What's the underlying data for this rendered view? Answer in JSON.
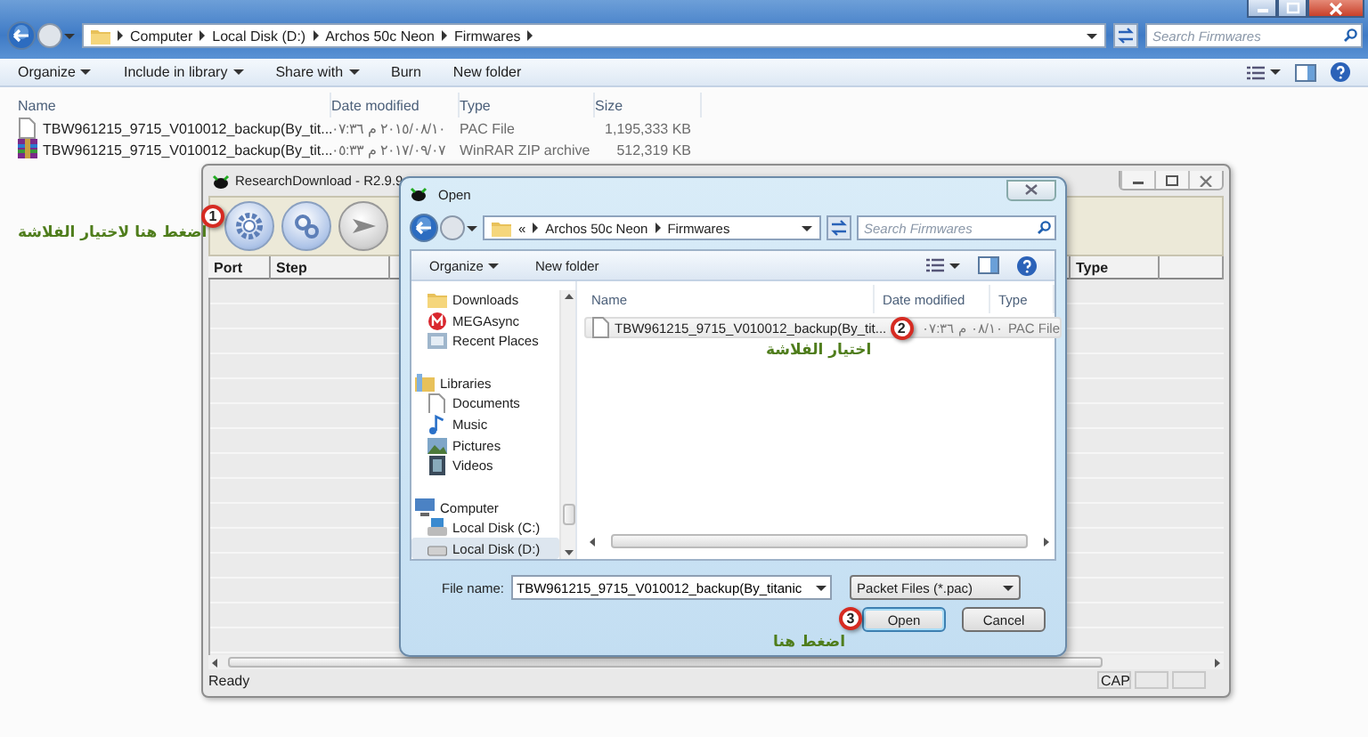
{
  "explorer": {
    "address": [
      "Computer",
      "Local Disk (D:)",
      "Archos 50c Neon",
      "Firmwares"
    ],
    "search": {
      "placeholder": "Search Firmwares"
    },
    "toolbar": [
      {
        "label": "Organize",
        "dropdown": true
      },
      {
        "label": "Include in library",
        "dropdown": true
      },
      {
        "label": "Share with",
        "dropdown": true
      },
      {
        "label": "Burn",
        "dropdown": false
      },
      {
        "label": "New folder",
        "dropdown": false
      }
    ],
    "columns": [
      "Name",
      "Date modified",
      "Type",
      "Size"
    ],
    "files": [
      {
        "name": "TBW961215_9715_V010012_backup(By_tit...",
        "date": "٢٠١٥/٠٨/١٠ م ٠٧:٣٦",
        "type": "PAC File",
        "size": "1,195,333 KB",
        "kind": "document"
      },
      {
        "name": "TBW961215_9715_V010012_backup(By_tit...",
        "date": "٢٠١٧/٠٩/٠٧ م ٠٥:٣٣",
        "type": "WinRAR ZIP archive",
        "size": "512,319 KB",
        "kind": "archive"
      }
    ]
  },
  "research_download": {
    "title": "ResearchDownload - R2.9.9",
    "columns": [
      "Port",
      "Step",
      "Type"
    ],
    "status": {
      "message": "Ready",
      "caps": "CAP"
    }
  },
  "open_dialog": {
    "title": "Open",
    "address_overflow": "«",
    "address": [
      "Archos 50c Neon",
      "Firmwares"
    ],
    "search": {
      "placeholder": "Search Firmwares"
    },
    "toolbar": [
      {
        "label": "Organize",
        "dropdown": true
      },
      {
        "label": "New folder",
        "dropdown": false
      }
    ],
    "nav": [
      {
        "label": "Downloads",
        "selected": false
      },
      {
        "label": "MEGAsync",
        "selected": false
      },
      {
        "label": "Recent Places",
        "selected": false
      },
      {
        "label": "Libraries",
        "selected": false,
        "children": [
          {
            "label": "Documents",
            "selected": false
          },
          {
            "label": "Music",
            "selected": false
          },
          {
            "label": "Pictures",
            "selected": false
          },
          {
            "label": "Videos",
            "selected": false
          }
        ]
      },
      {
        "label": "Computer",
        "selected": false,
        "children": [
          {
            "label": "Local Disk (C:)",
            "selected": false
          },
          {
            "label": "Local Disk (D:)",
            "selected": true
          }
        ]
      }
    ],
    "columns": [
      "Name",
      "Date modified",
      "Type"
    ],
    "files": [
      {
        "name": "TBW961215_9715_V010012_backup(By_tit...",
        "date": "٠٨/١٠ م ٠٧:٣٦",
        "type": "PAC File",
        "selected": true
      }
    ],
    "file_name": {
      "label": "File name:",
      "value": "TBW961215_9715_V010012_backup(By_titanic"
    },
    "file_type": "Packet Files (*.pac)",
    "buttons": [
      "Open",
      "Cancel"
    ]
  },
  "steps": [
    {
      "number": "1",
      "note": "اضغط هنا لاختيار الفلاشة"
    },
    {
      "number": "2",
      "note": "اختيار الفلاشة"
    },
    {
      "number": "3",
      "note": "اضغط هنا"
    }
  ]
}
